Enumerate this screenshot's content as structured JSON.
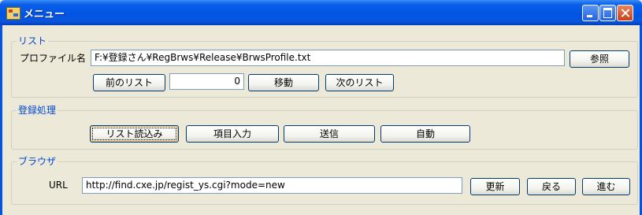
{
  "window": {
    "title": "メニュー"
  },
  "list_group": {
    "title": "リスト",
    "profile_label": "プロファイル名",
    "profile_path": "F:¥登録さん¥RegBrws¥Release¥BrwsProfile.txt",
    "browse_button": "参照",
    "prev_button": "前のリスト",
    "index_value": "0",
    "move_button": "移動",
    "next_button": "次のリスト"
  },
  "register_group": {
    "title": "登録処理",
    "load_button": "リスト読込み",
    "input_button": "項目入力",
    "send_button": "送信",
    "auto_button": "自動"
  },
  "browser_group": {
    "title": "ブラウザ",
    "url_label": "URL",
    "url_value": "http://find.cxe.jp/regist_ys.cgi?mode=new",
    "refresh_button": "更新",
    "back_button": "戻る",
    "forward_button": "進む"
  }
}
